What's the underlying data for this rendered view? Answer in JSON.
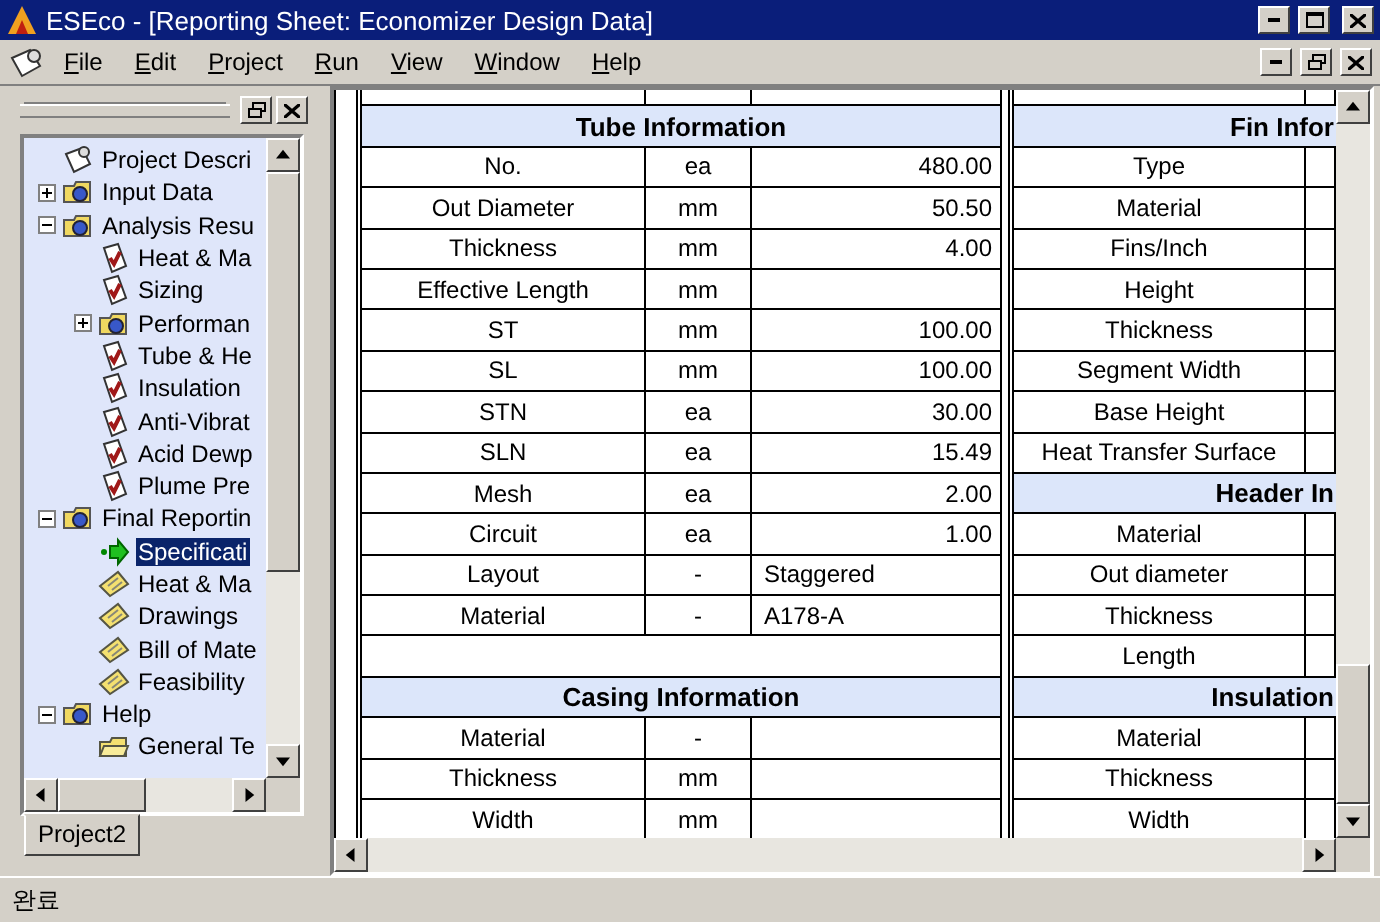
{
  "window": {
    "title": "ESEco - [Reporting Sheet: Economizer Design Data]"
  },
  "menu": [
    "File",
    "Edit",
    "Project",
    "Run",
    "View",
    "Window",
    "Help"
  ],
  "tree": [
    {
      "label": "Project Descri",
      "kind": "project",
      "selected": false
    },
    {
      "label": "Input Data",
      "kind": "group",
      "selected": false,
      "expanded": false
    },
    {
      "label": "Analysis Resu",
      "kind": "group",
      "selected": false,
      "expanded": true,
      "children": [
        {
          "label": "Heat & Ma",
          "kind": "check",
          "selected": false
        },
        {
          "label": "Sizing",
          "kind": "check",
          "selected": false
        },
        {
          "label": "Performan",
          "kind": "group",
          "selected": false,
          "expanded": false
        },
        {
          "label": "Tube & He",
          "kind": "check",
          "selected": false
        },
        {
          "label": "Insulation",
          "kind": "check",
          "selected": false
        },
        {
          "label": "Anti-Vibrat",
          "kind": "check",
          "selected": false
        },
        {
          "label": "Acid Dewp",
          "kind": "check",
          "selected": false
        },
        {
          "label": "Plume Pre",
          "kind": "check",
          "selected": false
        }
      ]
    },
    {
      "label": "Final Reportin",
      "kind": "group",
      "selected": false,
      "expanded": true,
      "children": [
        {
          "label": "Specificati",
          "kind": "current",
          "selected": true
        },
        {
          "label": "Heat & Ma",
          "kind": "report",
          "selected": false
        },
        {
          "label": "Drawings",
          "kind": "report",
          "selected": false
        },
        {
          "label": "Bill of Mate",
          "kind": "report",
          "selected": false
        },
        {
          "label": "Feasibility",
          "kind": "report",
          "selected": false
        }
      ]
    },
    {
      "label": "Help",
      "kind": "group",
      "selected": false,
      "expanded": true,
      "children": [
        {
          "label": "General Te",
          "kind": "help",
          "selected": false
        }
      ]
    }
  ],
  "panel_tabs": [
    {
      "label": "Project2",
      "selected": true
    }
  ],
  "left_table": [
    {
      "kind": "header",
      "title": "Tube Information"
    },
    {
      "kind": "row",
      "label": "No.",
      "unit": "ea",
      "value": "480.00"
    },
    {
      "kind": "row",
      "label": "Out Diameter",
      "unit": "mm",
      "value": "50.50"
    },
    {
      "kind": "row",
      "label": "Thickness",
      "unit": "mm",
      "value": "4.00"
    },
    {
      "kind": "row",
      "label": "Effective Length",
      "unit": "mm"
    },
    {
      "kind": "row",
      "label": "ST",
      "unit": "mm",
      "value": "100.00"
    },
    {
      "kind": "row",
      "label": "SL",
      "unit": "mm",
      "value": "100.00"
    },
    {
      "kind": "row",
      "label": "STN",
      "unit": "ea",
      "value": "30.00"
    },
    {
      "kind": "row",
      "label": "SLN",
      "unit": "ea",
      "value": "15.49"
    },
    {
      "kind": "row",
      "label": "Mesh",
      "unit": "ea",
      "value": "2.00"
    },
    {
      "kind": "row",
      "label": "Circuit",
      "unit": "ea",
      "value": "1.00"
    },
    {
      "kind": "text",
      "label": "Layout",
      "unit": "-",
      "value": "Staggered"
    },
    {
      "kind": "text",
      "label": "Material",
      "unit": "-",
      "value": "A178-A"
    },
    {
      "kind": "blank"
    },
    {
      "kind": "header",
      "title": "Casing Information"
    },
    {
      "kind": "row",
      "label": "Material",
      "unit": "-"
    },
    {
      "kind": "row",
      "label": "Thickness",
      "unit": "mm"
    },
    {
      "kind": "row",
      "label": "Width",
      "unit": "mm"
    }
  ],
  "right_table": [
    {
      "kind": "header",
      "title": "Fin Infor"
    },
    {
      "kind": "row",
      "label": "Type"
    },
    {
      "kind": "row",
      "label": "Material"
    },
    {
      "kind": "row",
      "label": "Fins/Inch"
    },
    {
      "kind": "row",
      "label": "Height"
    },
    {
      "kind": "row",
      "label": "Thickness"
    },
    {
      "kind": "row",
      "label": "Segment Width"
    },
    {
      "kind": "row",
      "label": "Base Height"
    },
    {
      "kind": "row",
      "label": "Heat Transfer Surface"
    },
    {
      "kind": "header",
      "title": "Header In"
    },
    {
      "kind": "row",
      "label": "Material"
    },
    {
      "kind": "row",
      "label": "Out diameter"
    },
    {
      "kind": "row",
      "label": "Thickness"
    },
    {
      "kind": "row",
      "label": "Length"
    },
    {
      "kind": "header",
      "title": "Insulation"
    },
    {
      "kind": "row",
      "label": "Material"
    },
    {
      "kind": "row",
      "label": "Thickness"
    },
    {
      "kind": "row",
      "label": "Width"
    }
  ],
  "status_bar": "완료"
}
